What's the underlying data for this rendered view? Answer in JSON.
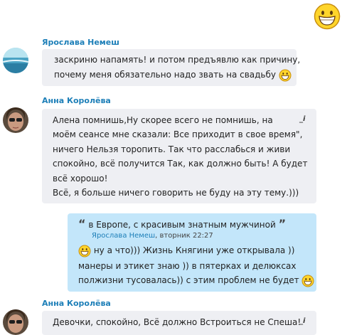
{
  "header": {
    "emoji_icon": "grinning-smiley-icon"
  },
  "messages": [
    {
      "sender": "Ярослава Немеш",
      "lines": [
        "заскриню напамять!  и потом предъявлю как причину,",
        "почему меня обязательно надо звать на свадьбу"
      ]
    },
    {
      "sender": "Анна Королёва",
      "lines": [
        "Алена помнишь,Ну  скорее всего не помнишь, на",
        "моём сеансе мне сказали: Все приходит в свое время\",",
        "ничего Нельзя торопить. Так что расслабься и живи",
        "спокойно, всё получится Так, как должно быть! А будет",
        "всё хорошо!",
        " Всё, я больше ничего говорить не буду на эту тему.)))"
      ],
      "edit_glyph": "_i"
    },
    {
      "quote": {
        "open_mark": "“",
        "text": "в Европе, с красивым знатным мужчиной",
        "close_mark": "”",
        "author": "Ярослава Немеш",
        "timestamp": ", вторник 22:27"
      },
      "lines": [
        "  ну а что))) Жизнь Княгини уже открывала ))",
        "манеры и этикет знаю )) в пятерках и делюксах",
        "полжизни тусовалась)) с этим проблем не будет"
      ]
    },
    {
      "sender": "Анна Королёва",
      "lines": [
        "Девочки, спокойно, Всё должно Встроиться не Спеша!"
      ],
      "edit_glyph": "_i"
    }
  ]
}
